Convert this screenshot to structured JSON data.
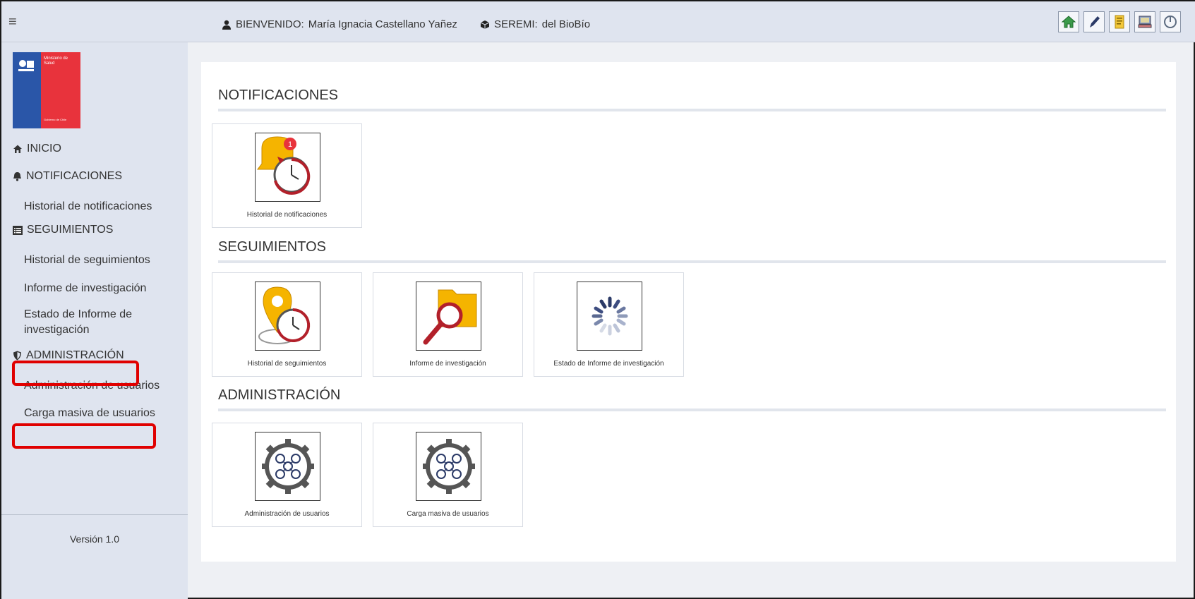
{
  "header": {
    "welcome_prefix": "BIENVENIDO:",
    "user_name": "María Ignacia Castellano Yañez",
    "seremi_prefix": "SEREMI:",
    "seremi_name": "del BioBío",
    "icons": [
      "home-icon",
      "pencil-icon",
      "document-icon",
      "computer-icon",
      "power-icon"
    ]
  },
  "logo": {
    "ministry": "Ministerio de Salud",
    "government": "Gobierno de Chile"
  },
  "sidebar": {
    "inicio": "INICIO",
    "notificaciones": "NOTIFICACIONES",
    "historial_notificaciones": "Historial de notificaciones",
    "seguimientos": "SEGUIMIENTOS",
    "historial_seguimientos": "Historial de seguimientos",
    "informe_investigacion": "Informe de investigación",
    "estado_informe": "Estado de Informe de investigación",
    "administracion": "ADMINISTRACIÓN",
    "admin_usuarios": "Administración de usuarios",
    "carga_masiva": "Carga masiva de usuarios",
    "version": "Versión 1.0"
  },
  "main": {
    "notificaciones_title": "NOTIFICACIONES",
    "seguimientos_title": "SEGUIMIENTOS",
    "administracion_title": "ADMINISTRACIÓN",
    "tiles": {
      "historial_notificaciones": "Historial de notificaciones",
      "historial_seguimientos": "Historial de seguimientos",
      "informe_investigacion": "Informe de investigación",
      "estado_informe": "Estado de Informe de investigación",
      "admin_usuarios": "Administración de usuarios",
      "carga_masiva": "Carga masiva de usuarios"
    },
    "notification_badge": "1"
  },
  "colors": {
    "highlight": "#e00000",
    "chile_blue": "#2a56a8",
    "chile_red": "#e8333c"
  }
}
